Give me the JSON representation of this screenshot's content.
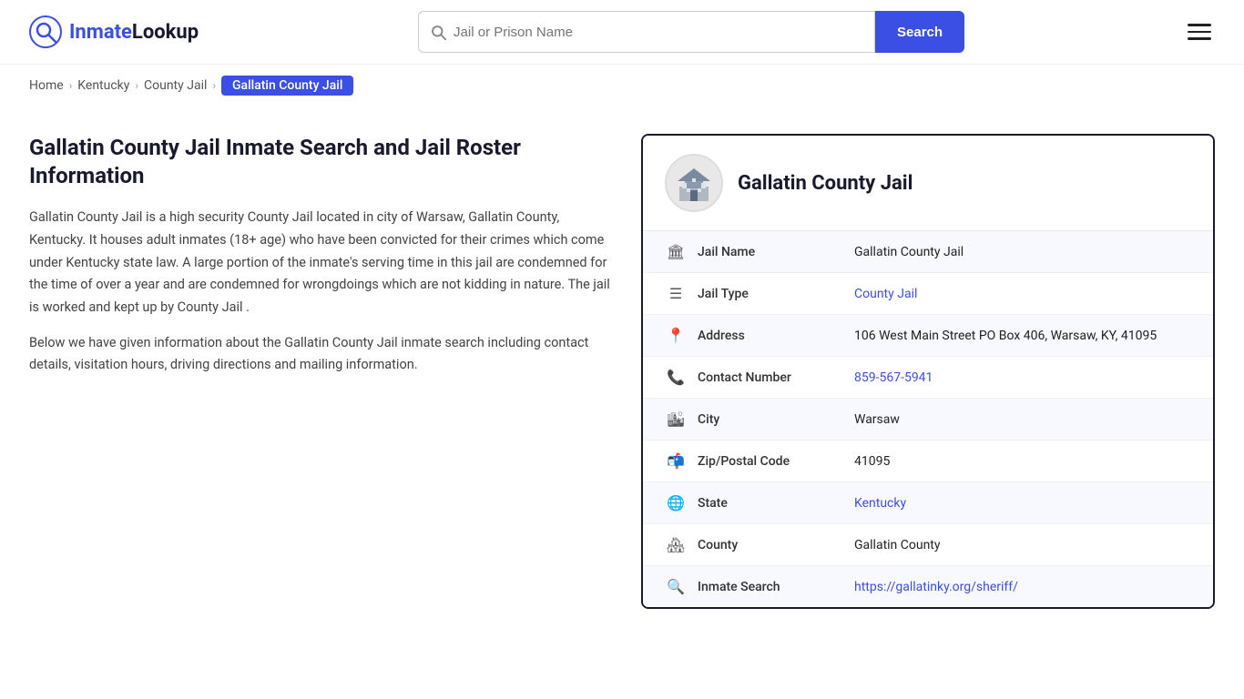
{
  "header": {
    "logo_brand": "Inmate",
    "logo_brand2": "Lookup",
    "search_placeholder": "Jail or Prison Name",
    "search_button_label": "Search"
  },
  "breadcrumb": {
    "home": "Home",
    "state": "Kentucky",
    "type": "County Jail",
    "current": "Gallatin County Jail"
  },
  "left": {
    "page_title": "Gallatin County Jail Inmate Search and Jail Roster Information",
    "desc1": "Gallatin County Jail is a high security County Jail located in city of Warsaw, Gallatin County, Kentucky. It houses adult inmates (18+ age) who have been convicted for their crimes which come under Kentucky state law. A large portion of the inmate's serving time in this jail are condemned for the time of over a year and are condemned for wrongdoings which are not kidding in nature. The jail is worked and kept up by County Jail .",
    "desc2": "Below we have given information about the Gallatin County Jail inmate search including contact details, visitation hours, driving directions and mailing information."
  },
  "infocard": {
    "title": "Gallatin County Jail",
    "rows": [
      {
        "icon": "🏛",
        "label": "Jail Name",
        "value": "Gallatin County Jail",
        "link": null
      },
      {
        "icon": "☰",
        "label": "Jail Type",
        "value": "County Jail",
        "link": "#"
      },
      {
        "icon": "📍",
        "label": "Address",
        "value": "106 West Main Street PO Box 406, Warsaw, KY, 41095",
        "link": null
      },
      {
        "icon": "📞",
        "label": "Contact Number",
        "value": "859-567-5941",
        "link": "tel:859-567-5941"
      },
      {
        "icon": "🏙",
        "label": "City",
        "value": "Warsaw",
        "link": null
      },
      {
        "icon": "📬",
        "label": "Zip/Postal Code",
        "value": "41095",
        "link": null
      },
      {
        "icon": "🌐",
        "label": "State",
        "value": "Kentucky",
        "link": "#"
      },
      {
        "icon": "🏘",
        "label": "County",
        "value": "Gallatin County",
        "link": null
      },
      {
        "icon": "🔍",
        "label": "Inmate Search",
        "value": "https://gallatinky.org/sheriff/",
        "link": "https://gallatinky.org/sheriff/"
      }
    ]
  },
  "icons": {
    "search": "🔍",
    "hamburger": "☰"
  }
}
